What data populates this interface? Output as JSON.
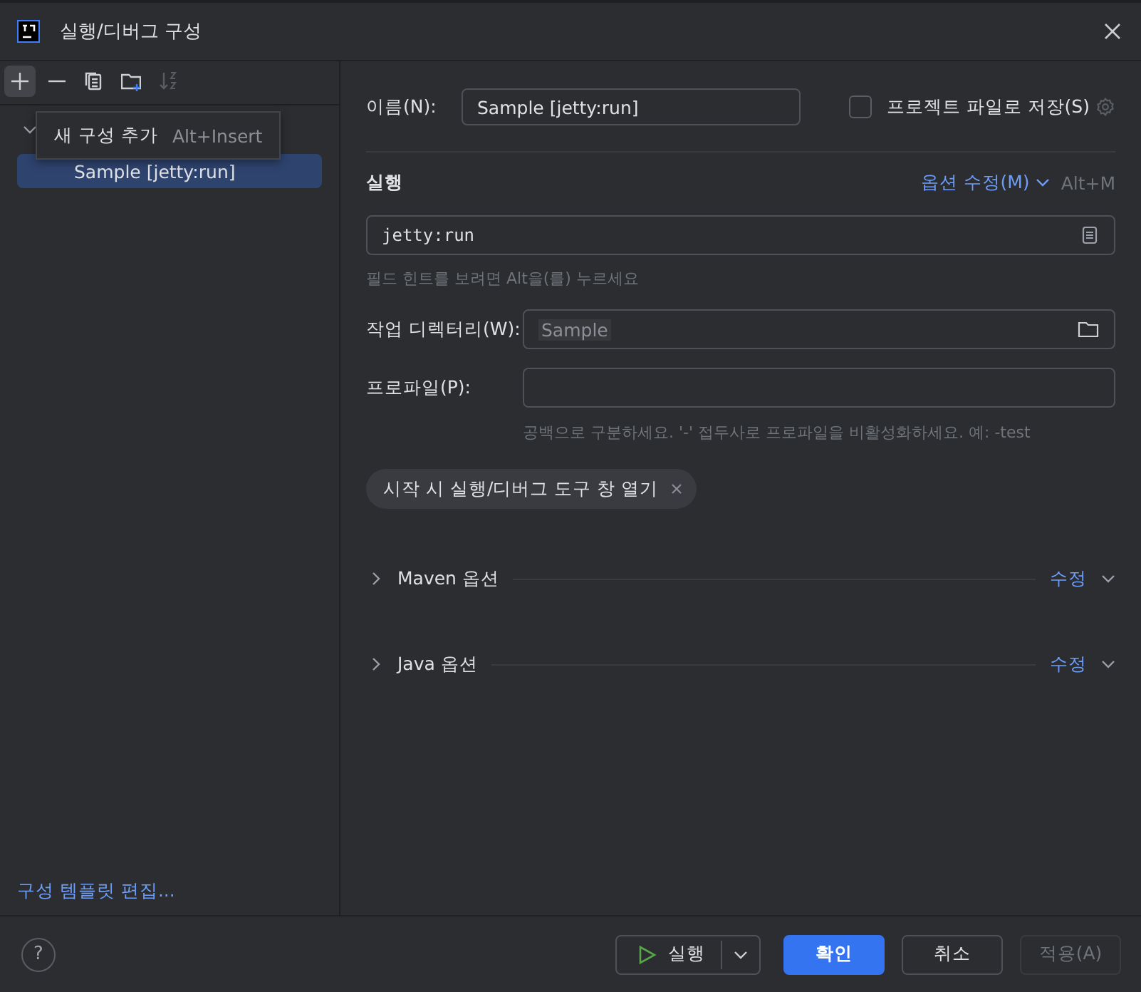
{
  "window": {
    "title": "실행/디버그 구성"
  },
  "toolbar": [
    {
      "kind": "add",
      "hovered": true,
      "disabled": false
    },
    {
      "kind": "remove",
      "hovered": false,
      "disabled": false
    },
    {
      "kind": "copy",
      "hovered": false,
      "disabled": false
    },
    {
      "kind": "folder",
      "hovered": false,
      "disabled": false
    },
    {
      "kind": "sort",
      "hovered": false,
      "disabled": true
    }
  ],
  "tooltip": {
    "text": "새 구성 추가",
    "shortcut": "Alt+Insert"
  },
  "tree": [
    {
      "expanded": true,
      "children": [
        {
          "label": "Sample [jetty:run]",
          "selected": true
        }
      ]
    }
  ],
  "edit_templates_link": "구성 템플릿 편집...",
  "name": {
    "label": "이름(N):",
    "value": "Sample [jetty:run]"
  },
  "store": {
    "label": "프로젝트 파일로 저장(S)",
    "checked": false
  },
  "run_section": {
    "title": "실행",
    "modify_link": "옵션 수정(M)",
    "shortcut": "Alt+M",
    "command": "jetty:run",
    "hint": "필드 힌트를 보려면 Alt을(를) 누르세요"
  },
  "working_dir": {
    "label": "작업 디렉터리(W):",
    "value": "Sample"
  },
  "profiles": {
    "label": "프로파일(P):",
    "hint": "공백으로 구분하세요. '-' 접두사로 프로파일을 비활성화하세요. 예: -test"
  },
  "chips": [
    "시작 시 실행/디버그 도구 창 열기"
  ],
  "groups": [
    {
      "title": "Maven 옵션",
      "action": "수정",
      "expanded": false
    },
    {
      "title": "Java 옵션",
      "action": "수정",
      "expanded": false
    }
  ],
  "footer": {
    "help": "?",
    "run": "실행",
    "ok": "확인",
    "cancel": "취소",
    "apply": {
      "label": "적용(A)",
      "disabled": true
    }
  }
}
